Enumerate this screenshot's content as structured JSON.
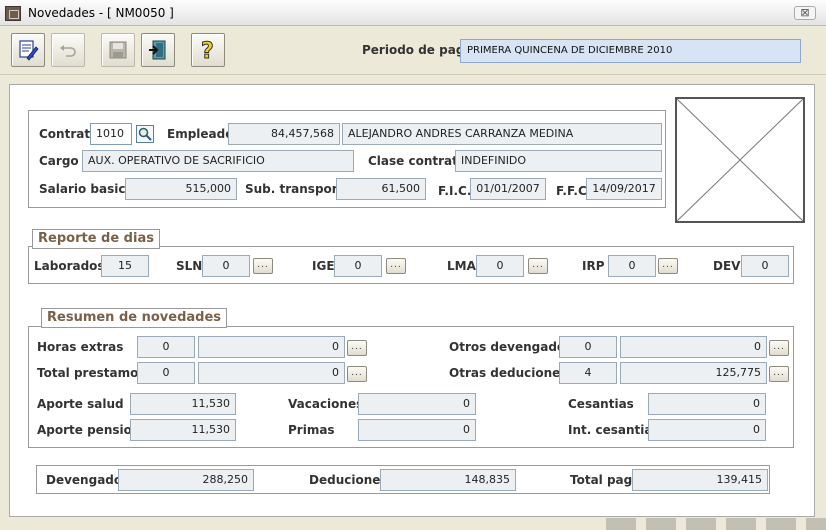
{
  "window": {
    "title": "Novedades - [ NM0050 ]",
    "close_symbol": "⊠"
  },
  "toolbar": {
    "buttons": [
      {
        "name": "edit-button",
        "icon": "edit-document-icon"
      },
      {
        "name": "undo-button",
        "icon": "undo-icon"
      },
      {
        "name": "save-button",
        "icon": "floppy-disk-icon"
      },
      {
        "name": "exit-button",
        "icon": "exit-door-icon"
      },
      {
        "name": "help-button",
        "icon": "help-question-icon"
      }
    ],
    "periodo_label": "Periodo de pago",
    "periodo_value": "PRIMERA QUINCENA DE DICIEMBRE 2010"
  },
  "employee": {
    "contrato_label": "Contrato",
    "contrato_value": "1010",
    "empleado_label": "Empleado",
    "empleado_id": "84,457,568",
    "empleado_name": "ALEJANDRO ANDRES CARRANZA MEDINA",
    "cargo_label": "Cargo",
    "cargo_value": "AUX. OPERATIVO DE SACRIFICIO",
    "clase_label": "Clase contrato",
    "clase_value": "INDEFINIDO",
    "salario_label": "Salario basico",
    "salario_value": "515,000",
    "subtrans_label": "Sub. transporte",
    "subtrans_value": "61,500",
    "fic_label": "F.I.C.",
    "fic_value": "01/01/2007",
    "ffc_label": "F.F.C",
    "ffc_value": "14/09/2017"
  },
  "reporte": {
    "title": "Reporte de dias",
    "laborados_label": "Laborados",
    "laborados_value": "15",
    "sln_label": "SLN",
    "sln_value": "0",
    "ige_label": "IGE",
    "ige_value": "0",
    "lma_label": "LMA",
    "lma_value": "0",
    "irp_label": "IRP",
    "irp_value": "0",
    "dev_label": "DEV",
    "dev_value": "0",
    "dots": "..."
  },
  "resumen": {
    "title": "Resumen de novedades",
    "horas_label": "Horas extras",
    "horas_count": "0",
    "horas_value": "0",
    "prestamos_label": "Total prestamos",
    "prestamos_count": "0",
    "prestamos_value": "0",
    "otros_dev_label": "Otros devengados",
    "otros_dev_count": "0",
    "otros_dev_value": "0",
    "otras_ded_label": "Otras deduciones",
    "otras_ded_count": "4",
    "otras_ded_value": "125,775",
    "salud_label": "Aporte salud",
    "salud_value": "11,530",
    "pension_label": "Aporte pension",
    "pension_value": "11,530",
    "vacaciones_label": "Vacaciones",
    "vacaciones_value": "0",
    "primas_label": "Primas",
    "primas_value": "0",
    "cesantias_label": "Cesantias",
    "cesantias_value": "0",
    "int_ces_label": "Int. cesantias",
    "int_ces_value": "0"
  },
  "totals": {
    "devengados_label": "Devengados",
    "devengados_value": "288,250",
    "deduciones_label": "Deduciones",
    "deduciones_value": "148,835",
    "total_label": "Total pago",
    "total_value": "139,415"
  }
}
